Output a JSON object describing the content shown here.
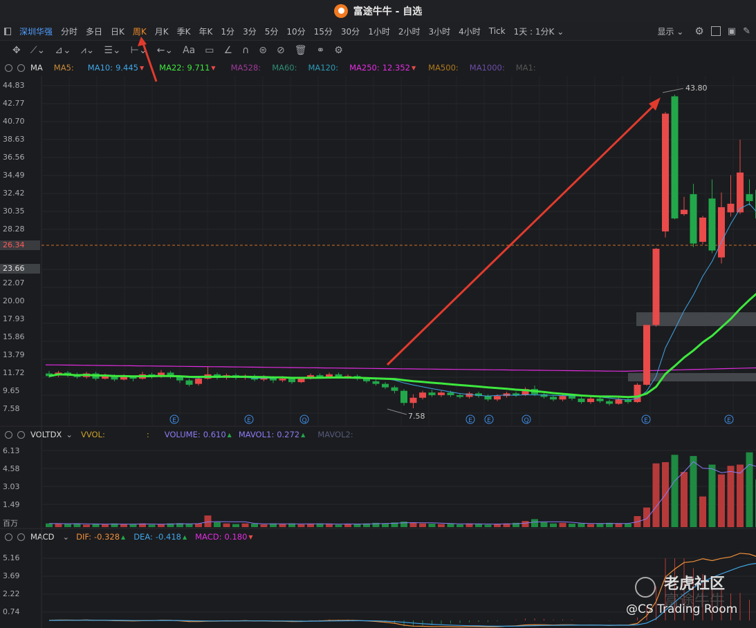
{
  "window": {
    "title": "富途牛牛 - 自选"
  },
  "period_tabs": {
    "symbol": "深圳华强",
    "items": [
      "分时",
      "多日",
      "日K",
      "周K",
      "月K",
      "季K",
      "年K",
      "1分",
      "3分",
      "5分",
      "10分",
      "15分",
      "30分",
      "1小时",
      "2小时",
      "3小时",
      "4小时",
      "Tick",
      "1天 : 1分K"
    ],
    "active": "周K",
    "display_label": "显示"
  },
  "main_legend": {
    "name": "MA",
    "items": [
      {
        "label": "MA5:",
        "value": "",
        "color": "#c98a3c"
      },
      {
        "label": "MA10:",
        "value": "9.445",
        "color": "#3fa6e8"
      },
      {
        "label": "MA22:",
        "value": "9.711",
        "color": "#3ee83e"
      },
      {
        "label": "MA528:",
        "value": "",
        "color": "#9d3a9a"
      },
      {
        "label": "MA60:",
        "value": "",
        "color": "#2f8c78"
      },
      {
        "label": "MA120:",
        "value": "",
        "color": "#2b9cb8"
      },
      {
        "label": "MA250:",
        "value": "12.352",
        "color": "#e22de2"
      },
      {
        "label": "MA500:",
        "value": "",
        "color": "#b07a1c"
      },
      {
        "label": "MA1000:",
        "value": "",
        "color": "#6d4da8"
      },
      {
        "label": "MA1:",
        "value": "",
        "color": "#555"
      }
    ]
  },
  "price_axis": [
    "44.83",
    "42.77",
    "40.70",
    "38.63",
    "36.56",
    "34.49",
    "32.42",
    "30.35",
    "28.28",
    "26.34",
    "23.66",
    "22.07",
    "20.00",
    "17.93",
    "15.86",
    "13.79",
    "11.72",
    "9.65",
    "7.58"
  ],
  "current_price": "26.34",
  "marker_price": "23.66",
  "annotations": {
    "high": "43.80",
    "low": "7.58"
  },
  "event_markers": {
    "e": "E",
    "q": "Q"
  },
  "volume_legend": {
    "name": "VOLTDX",
    "vvol_label": "VVOL:",
    "vvol_value": ":",
    "volume_label": "VOLUME:",
    "volume_value": "0.610",
    "mavol1_label": "MAVOL1:",
    "mavol1_value": "0.272",
    "mavol2_label": "MAVOL2:"
  },
  "volume_axis": [
    "6.13",
    "4.58",
    "3.03",
    "1.49",
    "百万"
  ],
  "macd_legend": {
    "name": "MACD",
    "dif_label": "DIF:",
    "dif_value": "-0.328",
    "dea_label": "DEA:",
    "dea_value": "-0.418",
    "macd_label": "MACD:",
    "macd_value": "0.180"
  },
  "macd_axis": [
    "5.16",
    "3.69",
    "2.22",
    "0.74"
  ],
  "watermark": {
    "brand": "老虎社区",
    "sub": "富途牛牛",
    "credit": "@CS Trading Room"
  },
  "colors": {
    "up": "#e94a4a",
    "down": "#22a84a",
    "ma10": "#3fa6e8",
    "ma22": "#3ee83e",
    "ma250": "#e22de2",
    "accent": "#f08a2a"
  },
  "chart_data": {
    "type": "candlestick",
    "ylim": [
      7.58,
      44.83
    ],
    "weeks": [
      {
        "o": 11.6,
        "c": 11.3,
        "h": 11.9,
        "l": 11.1
      },
      {
        "o": 11.4,
        "c": 11.7,
        "h": 11.9,
        "l": 11.2
      },
      {
        "o": 11.7,
        "c": 11.4,
        "h": 11.9,
        "l": 11.2
      },
      {
        "o": 11.5,
        "c": 11.2,
        "h": 11.7,
        "l": 11.0
      },
      {
        "o": 11.2,
        "c": 11.6,
        "h": 11.8,
        "l": 11.0
      },
      {
        "o": 11.6,
        "c": 11.0,
        "h": 11.8,
        "l": 10.8
      },
      {
        "o": 11.0,
        "c": 11.4,
        "h": 11.6,
        "l": 10.9
      },
      {
        "o": 11.3,
        "c": 10.9,
        "h": 11.5,
        "l": 10.7
      },
      {
        "o": 10.9,
        "c": 11.2,
        "h": 11.5,
        "l": 10.8
      },
      {
        "o": 11.2,
        "c": 11.0,
        "h": 11.4,
        "l": 10.7
      },
      {
        "o": 11.0,
        "c": 11.5,
        "h": 11.8,
        "l": 10.9
      },
      {
        "o": 11.5,
        "c": 11.3,
        "h": 11.7,
        "l": 11.0
      },
      {
        "o": 11.3,
        "c": 11.7,
        "h": 12.0,
        "l": 11.1
      },
      {
        "o": 11.7,
        "c": 11.2,
        "h": 11.9,
        "l": 11.0
      },
      {
        "o": 11.2,
        "c": 10.8,
        "h": 11.4,
        "l": 10.5
      },
      {
        "o": 10.8,
        "c": 10.3,
        "h": 11.0,
        "l": 10.1
      },
      {
        "o": 10.4,
        "c": 11.0,
        "h": 11.2,
        "l": 10.2
      },
      {
        "o": 11.0,
        "c": 11.5,
        "h": 12.4,
        "l": 10.9
      },
      {
        "o": 11.5,
        "c": 11.1,
        "h": 11.7,
        "l": 10.9
      },
      {
        "o": 11.1,
        "c": 11.4,
        "h": 11.6,
        "l": 10.9
      },
      {
        "o": 11.4,
        "c": 11.1,
        "h": 11.6,
        "l": 10.9
      },
      {
        "o": 11.1,
        "c": 11.3,
        "h": 11.5,
        "l": 10.9
      },
      {
        "o": 11.3,
        "c": 10.9,
        "h": 11.5,
        "l": 10.7
      },
      {
        "o": 10.9,
        "c": 11.2,
        "h": 11.4,
        "l": 10.7
      },
      {
        "o": 11.2,
        "c": 10.8,
        "h": 11.3,
        "l": 10.5
      },
      {
        "o": 10.8,
        "c": 11.0,
        "h": 11.3,
        "l": 10.6
      },
      {
        "o": 11.0,
        "c": 10.6,
        "h": 11.2,
        "l": 10.4
      },
      {
        "o": 10.6,
        "c": 11.0,
        "h": 11.2,
        "l": 10.5
      },
      {
        "o": 11.0,
        "c": 11.4,
        "h": 11.6,
        "l": 10.9
      },
      {
        "o": 11.4,
        "c": 11.2,
        "h": 11.6,
        "l": 11.0
      },
      {
        "o": 11.2,
        "c": 11.5,
        "h": 11.7,
        "l": 11.0
      },
      {
        "o": 11.5,
        "c": 11.2,
        "h": 11.7,
        "l": 11.0
      },
      {
        "o": 11.2,
        "c": 11.3,
        "h": 11.5,
        "l": 11.0
      },
      {
        "o": 11.3,
        "c": 11.0,
        "h": 11.5,
        "l": 10.8
      },
      {
        "o": 11.0,
        "c": 10.7,
        "h": 11.2,
        "l": 10.5
      },
      {
        "o": 10.7,
        "c": 10.4,
        "h": 10.9,
        "l": 10.2
      },
      {
        "o": 10.4,
        "c": 10.0,
        "h": 10.6,
        "l": 9.8
      },
      {
        "o": 10.0,
        "c": 9.6,
        "h": 10.2,
        "l": 9.3
      },
      {
        "o": 9.6,
        "c": 8.2,
        "h": 9.8,
        "l": 7.9
      },
      {
        "o": 8.2,
        "c": 8.8,
        "h": 9.2,
        "l": 7.58
      },
      {
        "o": 8.8,
        "c": 9.4,
        "h": 9.6,
        "l": 8.6
      },
      {
        "o": 9.4,
        "c": 9.1,
        "h": 9.7,
        "l": 8.9
      },
      {
        "o": 9.1,
        "c": 9.4,
        "h": 9.6,
        "l": 8.9
      },
      {
        "o": 9.4,
        "c": 9.1,
        "h": 9.6,
        "l": 8.9
      },
      {
        "o": 9.1,
        "c": 8.9,
        "h": 9.3,
        "l": 8.7
      },
      {
        "o": 8.9,
        "c": 9.3,
        "h": 9.5,
        "l": 8.7
      },
      {
        "o": 9.3,
        "c": 9.0,
        "h": 9.5,
        "l": 8.8
      },
      {
        "o": 9.0,
        "c": 8.6,
        "h": 9.2,
        "l": 8.4
      },
      {
        "o": 8.6,
        "c": 9.0,
        "h": 9.2,
        "l": 8.4
      },
      {
        "o": 9.0,
        "c": 9.3,
        "h": 9.5,
        "l": 8.8
      },
      {
        "o": 9.3,
        "c": 9.1,
        "h": 9.5,
        "l": 8.9
      },
      {
        "o": 9.1,
        "c": 9.8,
        "h": 10.0,
        "l": 9.0
      },
      {
        "o": 9.8,
        "c": 9.2,
        "h": 10.2,
        "l": 9.0
      },
      {
        "o": 9.2,
        "c": 8.9,
        "h": 9.4,
        "l": 8.7
      },
      {
        "o": 8.9,
        "c": 8.6,
        "h": 9.1,
        "l": 8.4
      },
      {
        "o": 8.6,
        "c": 9.0,
        "h": 9.2,
        "l": 8.4
      },
      {
        "o": 9.0,
        "c": 8.7,
        "h": 9.2,
        "l": 8.5
      },
      {
        "o": 8.7,
        "c": 8.3,
        "h": 8.9,
        "l": 8.1
      },
      {
        "o": 8.3,
        "c": 8.7,
        "h": 8.9,
        "l": 8.1
      },
      {
        "o": 8.7,
        "c": 8.4,
        "h": 8.9,
        "l": 8.2
      },
      {
        "o": 8.4,
        "c": 8.1,
        "h": 8.6,
        "l": 7.9
      },
      {
        "o": 8.1,
        "c": 8.6,
        "h": 8.8,
        "l": 8.0
      },
      {
        "o": 8.6,
        "c": 8.3,
        "h": 8.8,
        "l": 8.1
      },
      {
        "o": 8.3,
        "c": 10.3,
        "h": 10.5,
        "l": 8.2
      },
      {
        "o": 10.3,
        "c": 17.2,
        "h": 17.2,
        "l": 10.2
      },
      {
        "o": 17.2,
        "c": 26.0,
        "h": 26.1,
        "l": 17.0
      },
      {
        "o": 28.0,
        "c": 41.6,
        "h": 41.8,
        "l": 27.3
      },
      {
        "o": 43.6,
        "c": 29.5,
        "h": 43.8,
        "l": 29.4
      },
      {
        "o": 30.0,
        "c": 30.5,
        "h": 32.0,
        "l": 29.8
      },
      {
        "o": 32.3,
        "c": 26.6,
        "h": 33.5,
        "l": 26.2
      },
      {
        "o": 26.8,
        "c": 29.6,
        "h": 29.8,
        "l": 26.5
      },
      {
        "o": 31.8,
        "c": 25.8,
        "h": 34.0,
        "l": 25.5
      },
      {
        "o": 25.0,
        "c": 30.8,
        "h": 32.5,
        "l": 24.3
      },
      {
        "o": 30.2,
        "c": 31.2,
        "h": 34.5,
        "l": 29.7
      },
      {
        "o": 30.2,
        "c": 34.8,
        "h": 38.6,
        "l": 30.0
      },
      {
        "o": 32.3,
        "c": 31.5,
        "h": 34.0,
        "l": 31.0
      },
      {
        "o": 32.8,
        "c": 29.5,
        "h": 33.5,
        "l": 29.2
      },
      {
        "o": 29.7,
        "c": 28.3,
        "h": 30.5,
        "l": 28.0
      }
    ],
    "volume": [
      0.3,
      0.28,
      0.25,
      0.3,
      0.2,
      0.26,
      0.22,
      0.3,
      0.25,
      0.22,
      0.3,
      0.2,
      0.25,
      0.3,
      0.32,
      0.28,
      0.3,
      0.95,
      0.4,
      0.3,
      0.25,
      0.3,
      0.28,
      0.22,
      0.3,
      0.25,
      0.3,
      0.22,
      0.28,
      0.3,
      0.25,
      0.2,
      0.28,
      0.25,
      0.3,
      0.35,
      0.3,
      0.38,
      0.45,
      0.35,
      0.3,
      0.28,
      0.25,
      0.3,
      0.22,
      0.3,
      0.25,
      0.2,
      0.28,
      0.3,
      0.35,
      0.5,
      0.65,
      0.4,
      0.3,
      0.35,
      0.28,
      0.3,
      0.25,
      0.3,
      0.35,
      0.3,
      0.28,
      0.9,
      1.6,
      5.2,
      5.3,
      5.9,
      4.5,
      5.8,
      2.5,
      5.1,
      4.3,
      5.0,
      5.1,
      6.1,
      3.9,
      3.2
    ],
    "macd": {
      "dif_last": -0.328,
      "dea_last": -0.418,
      "macd_last": 0.18
    }
  }
}
